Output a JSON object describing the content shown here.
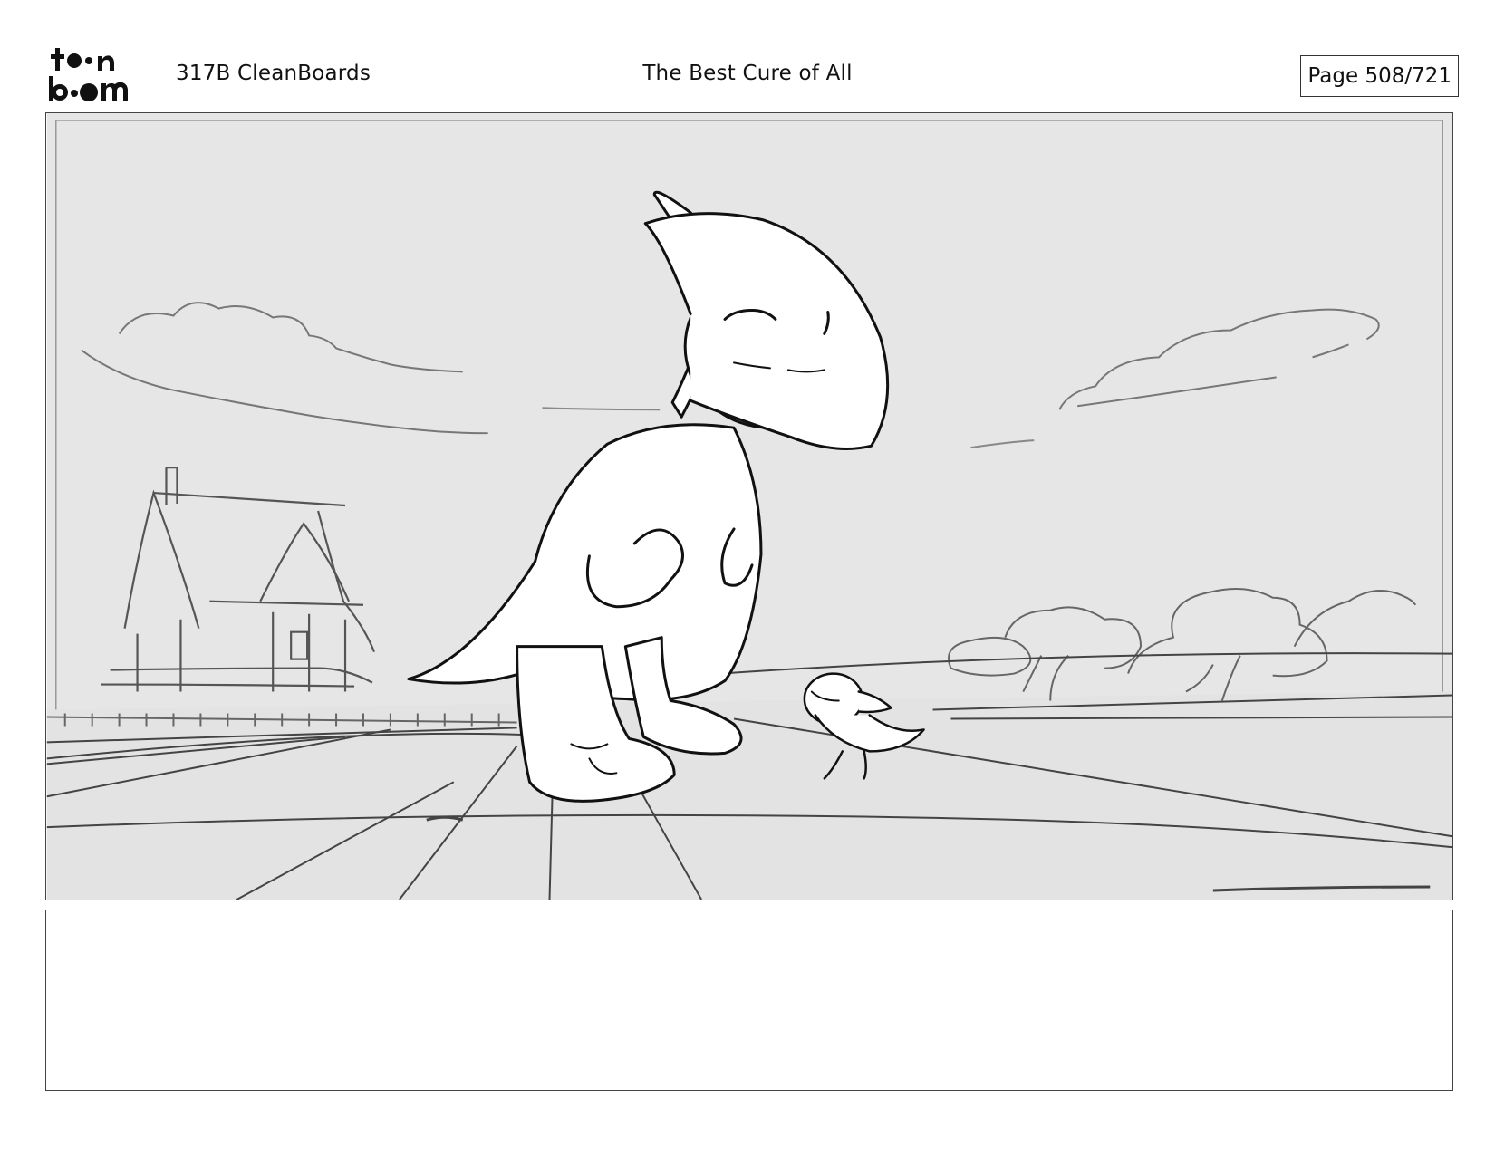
{
  "header": {
    "logo_text": "toonboom",
    "episode": "317B  CleanBoards",
    "title": "The Best Cure of All",
    "page": "Page 508/721"
  },
  "notes": {
    "text": ""
  },
  "colors": {
    "sky": "#e6e6e6",
    "ground": "#e3e3e3",
    "ink": "#111111",
    "line_gray": "#888888"
  },
  "icons": {
    "logo": "toonboom-logo"
  }
}
